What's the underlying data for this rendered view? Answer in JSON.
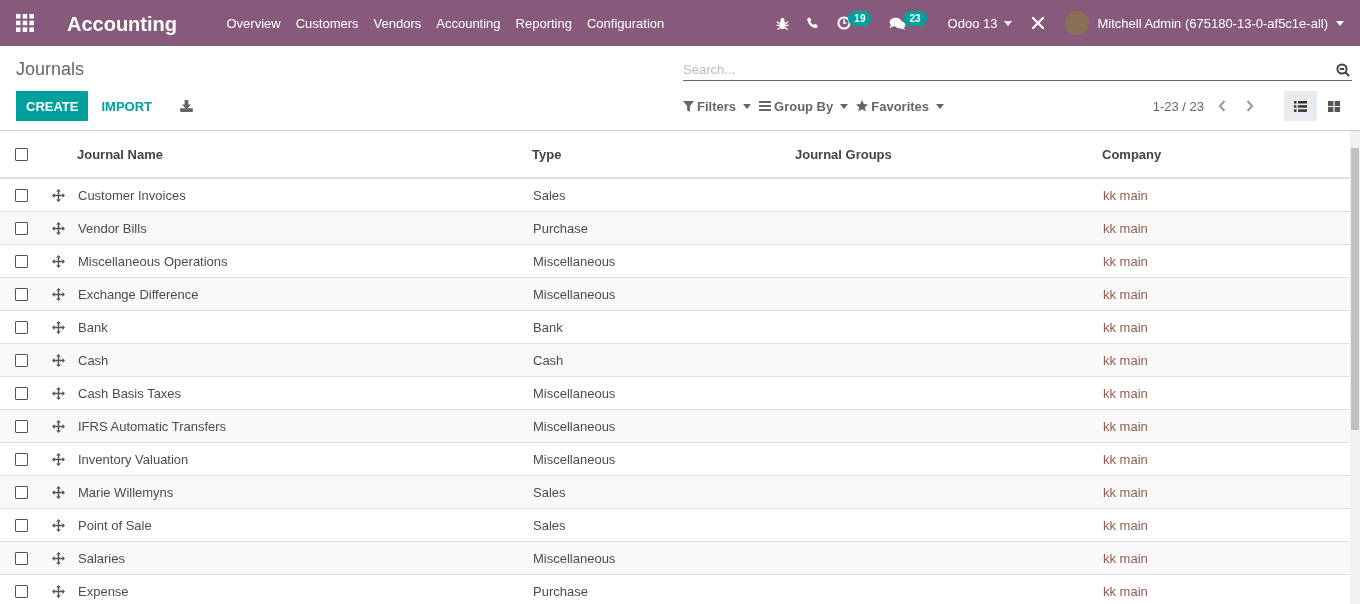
{
  "navbar": {
    "app_title": "Accounting",
    "menu": [
      "Overview",
      "Customers",
      "Vendors",
      "Accounting",
      "Reporting",
      "Configuration"
    ],
    "activity_count": "19",
    "message_count": "23",
    "company": "Odoo 13",
    "user": "Mitchell Admin (675180-13-0-af5c1e-all)"
  },
  "control_panel": {
    "title": "Journals",
    "buttons": [
      {
        "label": "CREATE",
        "kind": "primary"
      },
      {
        "label": "IMPORT",
        "kind": "link"
      }
    ],
    "search": {
      "placeholder": "Search..."
    },
    "search_options": [
      {
        "label": "Filters",
        "kind": "filter"
      },
      {
        "label": "Group By",
        "kind": "group"
      },
      {
        "label": "Favorites",
        "kind": "star"
      }
    ],
    "pager": "1-23 / 23",
    "views": [
      {
        "kind": "list",
        "selected": true
      },
      {
        "kind": "kanban",
        "selected": false
      }
    ]
  },
  "table": {
    "select_all": {
      "checked": false
    },
    "columns": [
      "Journal Name",
      "Type",
      "Journal Groups",
      "Company"
    ],
    "rows": [
      {
        "checked": false,
        "name": "Customer Invoices",
        "type": "Sales",
        "company": "kk main"
      },
      {
        "checked": false,
        "name": "Vendor Bills",
        "type": "Purchase",
        "company": "kk main"
      },
      {
        "checked": false,
        "name": "Miscellaneous Operations",
        "type": "Miscellaneous",
        "company": "kk main"
      },
      {
        "checked": false,
        "name": "Exchange Difference",
        "type": "Miscellaneous",
        "company": "kk main"
      },
      {
        "checked": false,
        "name": "Bank",
        "type": "Bank",
        "company": "kk main"
      },
      {
        "checked": false,
        "name": "Cash",
        "type": "Cash",
        "company": "kk main"
      },
      {
        "checked": false,
        "name": "Cash Basis Taxes",
        "type": "Miscellaneous",
        "company": "kk main"
      },
      {
        "checked": false,
        "name": "IFRS Automatic Transfers",
        "type": "Miscellaneous",
        "company": "kk main"
      },
      {
        "checked": false,
        "name": "Inventory Valuation",
        "type": "Miscellaneous",
        "company": "kk main"
      },
      {
        "checked": false,
        "name": "Marie Willemyns",
        "type": "Sales",
        "company": "kk main"
      },
      {
        "checked": false,
        "name": "Point of Sale",
        "type": "Sales",
        "company": "kk main"
      },
      {
        "checked": false,
        "name": "Salaries",
        "type": "Miscellaneous",
        "company": "kk main"
      },
      {
        "checked": false,
        "name": "Expense",
        "type": "Purchase",
        "company": "kk main"
      }
    ]
  }
}
